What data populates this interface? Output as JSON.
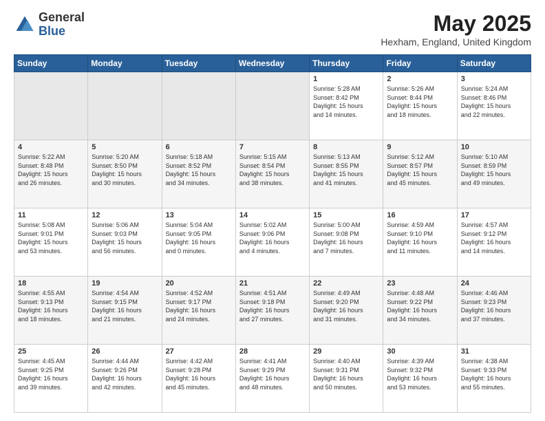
{
  "header": {
    "logo_general": "General",
    "logo_blue": "Blue",
    "month_title": "May 2025",
    "location": "Hexham, England, United Kingdom"
  },
  "days_of_week": [
    "Sunday",
    "Monday",
    "Tuesday",
    "Wednesday",
    "Thursday",
    "Friday",
    "Saturday"
  ],
  "weeks": [
    [
      {
        "day": "",
        "info": ""
      },
      {
        "day": "",
        "info": ""
      },
      {
        "day": "",
        "info": ""
      },
      {
        "day": "",
        "info": ""
      },
      {
        "day": "1",
        "info": "Sunrise: 5:28 AM\nSunset: 8:42 PM\nDaylight: 15 hours\nand 14 minutes."
      },
      {
        "day": "2",
        "info": "Sunrise: 5:26 AM\nSunset: 8:44 PM\nDaylight: 15 hours\nand 18 minutes."
      },
      {
        "day": "3",
        "info": "Sunrise: 5:24 AM\nSunset: 8:46 PM\nDaylight: 15 hours\nand 22 minutes."
      }
    ],
    [
      {
        "day": "4",
        "info": "Sunrise: 5:22 AM\nSunset: 8:48 PM\nDaylight: 15 hours\nand 26 minutes."
      },
      {
        "day": "5",
        "info": "Sunrise: 5:20 AM\nSunset: 8:50 PM\nDaylight: 15 hours\nand 30 minutes."
      },
      {
        "day": "6",
        "info": "Sunrise: 5:18 AM\nSunset: 8:52 PM\nDaylight: 15 hours\nand 34 minutes."
      },
      {
        "day": "7",
        "info": "Sunrise: 5:15 AM\nSunset: 8:54 PM\nDaylight: 15 hours\nand 38 minutes."
      },
      {
        "day": "8",
        "info": "Sunrise: 5:13 AM\nSunset: 8:55 PM\nDaylight: 15 hours\nand 41 minutes."
      },
      {
        "day": "9",
        "info": "Sunrise: 5:12 AM\nSunset: 8:57 PM\nDaylight: 15 hours\nand 45 minutes."
      },
      {
        "day": "10",
        "info": "Sunrise: 5:10 AM\nSunset: 8:59 PM\nDaylight: 15 hours\nand 49 minutes."
      }
    ],
    [
      {
        "day": "11",
        "info": "Sunrise: 5:08 AM\nSunset: 9:01 PM\nDaylight: 15 hours\nand 53 minutes."
      },
      {
        "day": "12",
        "info": "Sunrise: 5:06 AM\nSunset: 9:03 PM\nDaylight: 15 hours\nand 56 minutes."
      },
      {
        "day": "13",
        "info": "Sunrise: 5:04 AM\nSunset: 9:05 PM\nDaylight: 16 hours\nand 0 minutes."
      },
      {
        "day": "14",
        "info": "Sunrise: 5:02 AM\nSunset: 9:06 PM\nDaylight: 16 hours\nand 4 minutes."
      },
      {
        "day": "15",
        "info": "Sunrise: 5:00 AM\nSunset: 9:08 PM\nDaylight: 16 hours\nand 7 minutes."
      },
      {
        "day": "16",
        "info": "Sunrise: 4:59 AM\nSunset: 9:10 PM\nDaylight: 16 hours\nand 11 minutes."
      },
      {
        "day": "17",
        "info": "Sunrise: 4:57 AM\nSunset: 9:12 PM\nDaylight: 16 hours\nand 14 minutes."
      }
    ],
    [
      {
        "day": "18",
        "info": "Sunrise: 4:55 AM\nSunset: 9:13 PM\nDaylight: 16 hours\nand 18 minutes."
      },
      {
        "day": "19",
        "info": "Sunrise: 4:54 AM\nSunset: 9:15 PM\nDaylight: 16 hours\nand 21 minutes."
      },
      {
        "day": "20",
        "info": "Sunrise: 4:52 AM\nSunset: 9:17 PM\nDaylight: 16 hours\nand 24 minutes."
      },
      {
        "day": "21",
        "info": "Sunrise: 4:51 AM\nSunset: 9:18 PM\nDaylight: 16 hours\nand 27 minutes."
      },
      {
        "day": "22",
        "info": "Sunrise: 4:49 AM\nSunset: 9:20 PM\nDaylight: 16 hours\nand 31 minutes."
      },
      {
        "day": "23",
        "info": "Sunrise: 4:48 AM\nSunset: 9:22 PM\nDaylight: 16 hours\nand 34 minutes."
      },
      {
        "day": "24",
        "info": "Sunrise: 4:46 AM\nSunset: 9:23 PM\nDaylight: 16 hours\nand 37 minutes."
      }
    ],
    [
      {
        "day": "25",
        "info": "Sunrise: 4:45 AM\nSunset: 9:25 PM\nDaylight: 16 hours\nand 39 minutes."
      },
      {
        "day": "26",
        "info": "Sunrise: 4:44 AM\nSunset: 9:26 PM\nDaylight: 16 hours\nand 42 minutes."
      },
      {
        "day": "27",
        "info": "Sunrise: 4:42 AM\nSunset: 9:28 PM\nDaylight: 16 hours\nand 45 minutes."
      },
      {
        "day": "28",
        "info": "Sunrise: 4:41 AM\nSunset: 9:29 PM\nDaylight: 16 hours\nand 48 minutes."
      },
      {
        "day": "29",
        "info": "Sunrise: 4:40 AM\nSunset: 9:31 PM\nDaylight: 16 hours\nand 50 minutes."
      },
      {
        "day": "30",
        "info": "Sunrise: 4:39 AM\nSunset: 9:32 PM\nDaylight: 16 hours\nand 53 minutes."
      },
      {
        "day": "31",
        "info": "Sunrise: 4:38 AM\nSunset: 9:33 PM\nDaylight: 16 hours\nand 55 minutes."
      }
    ]
  ]
}
